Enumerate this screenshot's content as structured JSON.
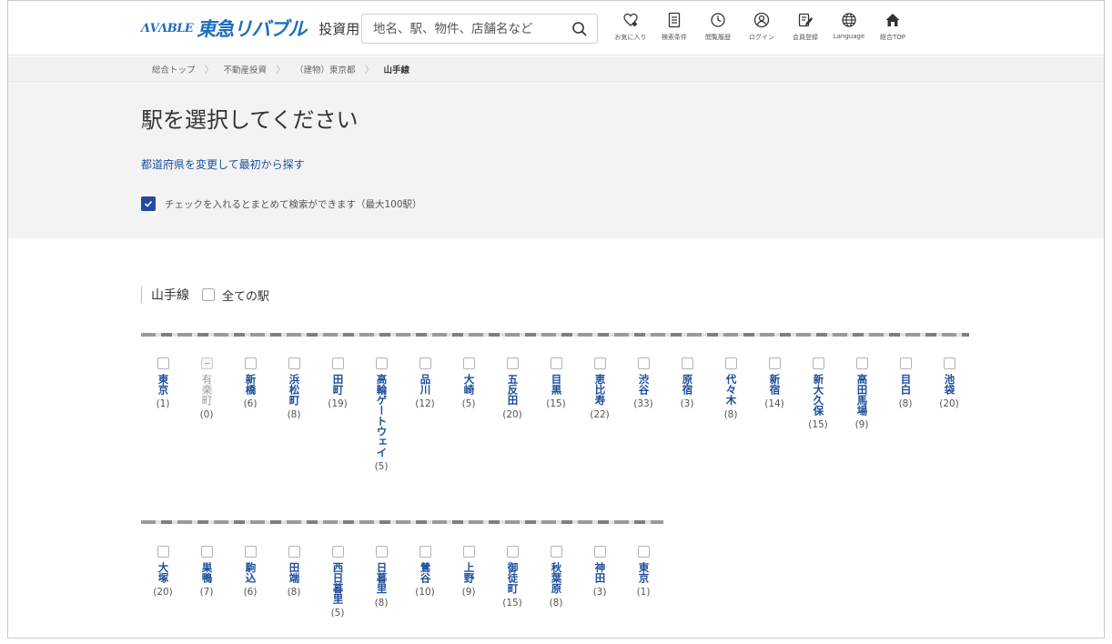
{
  "header": {
    "logo_mark": "ΛVΛBLE",
    "logo_brand": "東急リバブル",
    "logo_sub": "投資用",
    "search_placeholder": "地名、駅、物件、店舗名など",
    "nav": [
      {
        "label": "お気に入り",
        "icon": "heart-icon"
      },
      {
        "label": "検索条件",
        "icon": "document-icon"
      },
      {
        "label": "閲覧履歴",
        "icon": "clock-icon"
      },
      {
        "label": "ログイン",
        "icon": "user-icon"
      },
      {
        "label": "会員登録",
        "icon": "edit-icon"
      },
      {
        "label": "Language",
        "icon": "globe-icon"
      },
      {
        "label": "総合TOP",
        "icon": "home-icon"
      }
    ]
  },
  "breadcrumb": [
    "総合トップ",
    "不動産投資",
    "（建物）東京都",
    "山手線"
  ],
  "hero": {
    "title": "駅を選択してください",
    "change_link": "都道府県を変更して最初から探す",
    "tip": "チェックを入れるとまとめて検索ができます（最大100駅）"
  },
  "line": {
    "name": "山手線",
    "all_label": "全ての駅",
    "row1": [
      {
        "name": "東京",
        "count": "(1)",
        "disabled": false
      },
      {
        "name": "有楽町",
        "count": "(0)",
        "disabled": true
      },
      {
        "name": "新橋",
        "count": "(6)",
        "disabled": false
      },
      {
        "name": "浜松町",
        "count": "(8)",
        "disabled": false
      },
      {
        "name": "田町",
        "count": "(19)",
        "disabled": false
      },
      {
        "name": "高輪ゲートウェイ",
        "count": "(5)",
        "disabled": false
      },
      {
        "name": "品川",
        "count": "(12)",
        "disabled": false
      },
      {
        "name": "大崎",
        "count": "(5)",
        "disabled": false
      },
      {
        "name": "五反田",
        "count": "(20)",
        "disabled": false
      },
      {
        "name": "目黒",
        "count": "(15)",
        "disabled": false
      },
      {
        "name": "恵比寿",
        "count": "(22)",
        "disabled": false
      },
      {
        "name": "渋谷",
        "count": "(33)",
        "disabled": false
      },
      {
        "name": "原宿",
        "count": "(3)",
        "disabled": false
      },
      {
        "name": "代々木",
        "count": "(8)",
        "disabled": false
      },
      {
        "name": "新宿",
        "count": "(14)",
        "disabled": false
      },
      {
        "name": "新大久保",
        "count": "(15)",
        "disabled": false
      },
      {
        "name": "高田馬場",
        "count": "(9)",
        "disabled": false
      },
      {
        "name": "目白",
        "count": "(8)",
        "disabled": false
      },
      {
        "name": "池袋",
        "count": "(20)",
        "disabled": false
      }
    ],
    "row2": [
      {
        "name": "大塚",
        "count": "(20)",
        "disabled": false
      },
      {
        "name": "巣鴨",
        "count": "(7)",
        "disabled": false
      },
      {
        "name": "駒込",
        "count": "(6)",
        "disabled": false
      },
      {
        "name": "田端",
        "count": "(8)",
        "disabled": false
      },
      {
        "name": "西日暮里",
        "count": "(5)",
        "disabled": false
      },
      {
        "name": "日暮里",
        "count": "(8)",
        "disabled": false
      },
      {
        "name": "鶯谷",
        "count": "(10)",
        "disabled": false
      },
      {
        "name": "上野",
        "count": "(9)",
        "disabled": false
      },
      {
        "name": "御徒町",
        "count": "(15)",
        "disabled": false
      },
      {
        "name": "秋葉原",
        "count": "(8)",
        "disabled": false
      },
      {
        "name": "神田",
        "count": "(3)",
        "disabled": false
      },
      {
        "name": "東京",
        "count": "(1)",
        "disabled": false
      }
    ]
  }
}
